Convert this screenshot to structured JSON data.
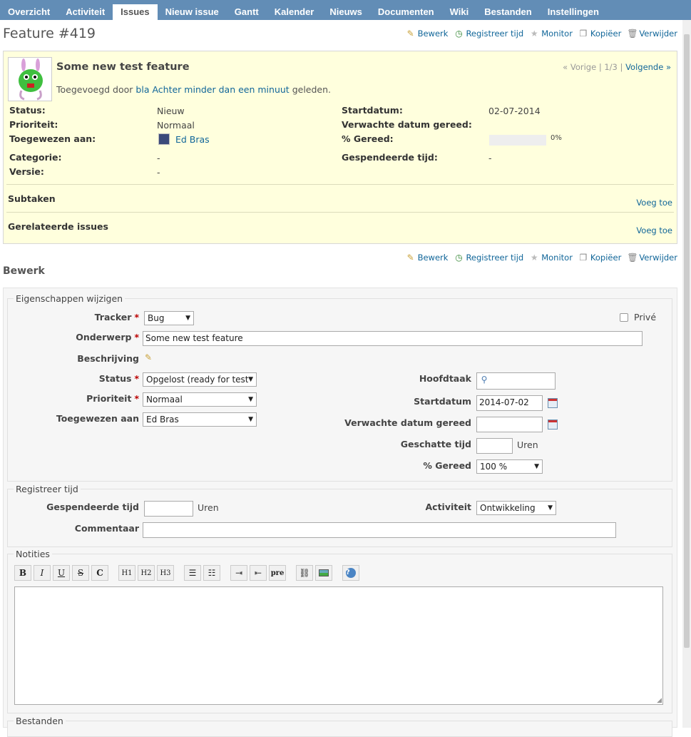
{
  "nav": {
    "items": [
      "Overzicht",
      "Activiteit",
      "Issues",
      "Nieuw issue",
      "Gantt",
      "Kalender",
      "Nieuws",
      "Documenten",
      "Wiki",
      "Bestanden",
      "Instellingen"
    ],
    "selected": "Issues"
  },
  "page_title": "Feature #419",
  "actions": {
    "edit": "Bewerk",
    "log_time": "Registreer tijd",
    "watch": "Monitor",
    "copy": "Kopiëer",
    "delete": "Verwijder"
  },
  "issue": {
    "subject": "Some new test feature",
    "author_prefix": "Toegevoegd door",
    "author": "bla",
    "age": "Achter minder dan een minuut",
    "age_suffix": "geleden.",
    "nav": {
      "prev": "« Vorige",
      "sep1": "|",
      "position": "1/3",
      "sep2": "|",
      "next": "Volgende »"
    },
    "status_label": "Status:",
    "status": "Nieuw",
    "priority_label": "Prioriteit:",
    "priority": "Normaal",
    "assigned_label": "Toegewezen aan:",
    "assigned": "Ed Bras",
    "category_label": "Categorie:",
    "category": "-",
    "version_label": "Versie:",
    "version": "-",
    "start_label": "Startdatum:",
    "start": "02-07-2014",
    "due_label": "Verwachte datum gereed:",
    "done_label": "% Gereed:",
    "done": 0,
    "done_text": "0%",
    "spent_label": "Gespendeerde tijd:",
    "spent": "-",
    "subtasks_label": "Subtaken",
    "related_label": "Gerelateerde issues",
    "add_label": "Voeg toe"
  },
  "edit": {
    "heading": "Bewerk",
    "props_legend": "Eigenschappen wijzigen",
    "tracker_label": "Tracker",
    "tracker": "Bug",
    "private_label": "Privé",
    "subject_label": "Onderwerp",
    "subject": "Some new test feature",
    "description_label": "Beschrijving",
    "status_label": "Status",
    "status": "Opgelost (ready for test",
    "priority_label": "Prioriteit",
    "priority": "Normaal",
    "assigned_label": "Toegewezen aan",
    "assigned": "Ed Bras",
    "parent_label": "Hoofdtaak",
    "start_label": "Startdatum",
    "start": "2014-07-02",
    "due_label": "Verwachte datum gereed",
    "estimate_label": "Geschatte tijd",
    "estimate_unit": "Uren",
    "done_label": "% Gereed",
    "done": "100 %",
    "time_legend": "Registreer tijd",
    "spent_label": "Gespendeerde tijd",
    "spent_unit": "Uren",
    "activity_label": "Activiteit",
    "activity": "Ontwikkeling",
    "comment_label": "Commentaar",
    "notes_legend": "Notities",
    "files_legend": "Bestanden"
  },
  "toolbar": {
    "bold": "B",
    "italic": "I",
    "underline": "U",
    "strike": "S",
    "code": "C",
    "h1": "H1",
    "h2": "H2",
    "h3": "H3",
    "pre": "pre"
  }
}
